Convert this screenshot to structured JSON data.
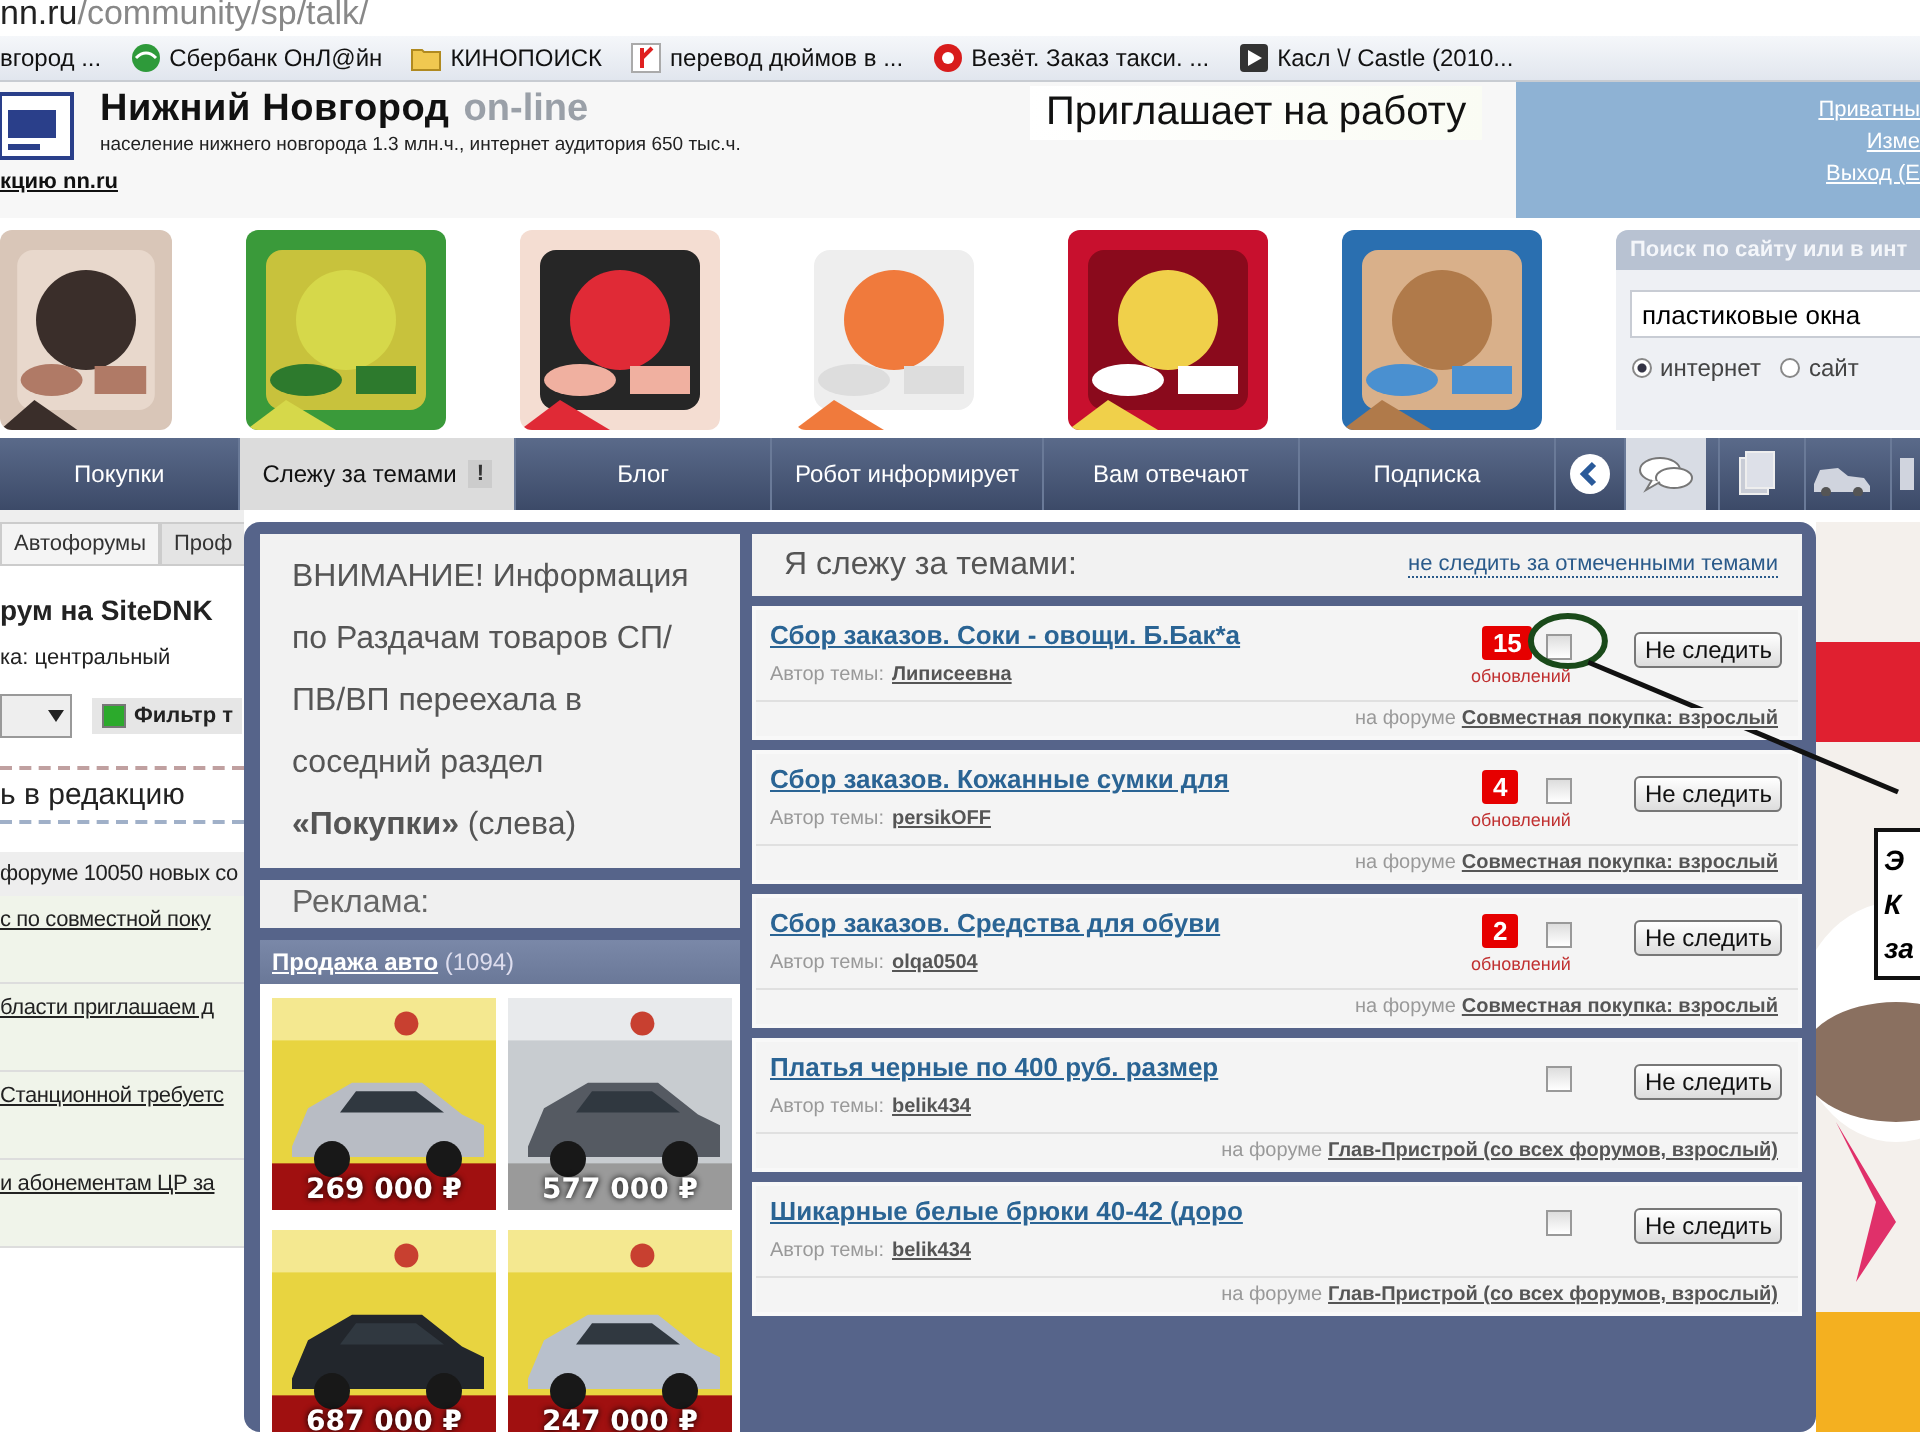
{
  "address_bar": {
    "host": "nn.ru",
    "path": "/community/sp/talk/"
  },
  "bookmarks": [
    {
      "label": "вгород ...",
      "kind": "page"
    },
    {
      "label": "Сбербанк ОнЛ@йн",
      "kind": "bank"
    },
    {
      "label": "КИНОПОИСК",
      "kind": "folder"
    },
    {
      "label": "перевод дюймов в ...",
      "kind": "yandex"
    },
    {
      "label": "Везёт. Заказ такси. ...",
      "kind": "taxi"
    },
    {
      "label": "Касл \\/ Castle (2010...",
      "kind": "video"
    }
  ],
  "header": {
    "title": "Нижний Новгород",
    "title_suffix": "on-line",
    "subtitle": "население нижнего новгорода 1.3 млн.ч., интернет аудитория 650 тыс.ч.",
    "link": "кцию nn.ru",
    "banner": "Приглашает на работу",
    "user_links": [
      "Приватны",
      "Изме",
      "Выход (Е"
    ]
  },
  "search": {
    "title": "Поиск по сайту или в инт",
    "value": "пластиковые окна",
    "options": [
      {
        "label": "интернет",
        "selected": true
      },
      {
        "label": "сайт",
        "selected": false
      }
    ]
  },
  "nav": {
    "tabs": [
      {
        "label": "Покупки",
        "selected": false
      },
      {
        "label": "Слежу за темами",
        "selected": true,
        "badge": "!"
      },
      {
        "label": "Блог",
        "selected": false
      },
      {
        "label": "Робот информирует",
        "selected": false
      },
      {
        "label": "Вам отвечают",
        "selected": false
      },
      {
        "label": "Подписка",
        "selected": false
      }
    ]
  },
  "left_panel": {
    "tabs": [
      {
        "label": "Автофорумы",
        "selected": true
      },
      {
        "label": "Проф",
        "selected": false
      }
    ],
    "heading": "рум на SiteDNK",
    "region": "ка: центральный",
    "filter": {
      "label": "Фильтр т",
      "checked": true
    },
    "editorial": "ь в редакцию",
    "stats": "форуме 10050 новых со",
    "links": [
      "с по совместной поку",
      "бласти приглашаем д",
      "Станционной требуетс",
      "и абонементам ЦР за"
    ]
  },
  "popup": {
    "notice": "ВНИМАНИЕ! Информация по Раздачам товаров СП/ПВ/ВП переехала в соседний раздел **«Покупки»** (слева)",
    "ads_title": "Реклама:",
    "ad_block": {
      "link": "Продажа авто",
      "count": "(1094)",
      "cars": [
        {
          "price": "269 000 ₽",
          "kind": "picture"
        },
        {
          "price": "577 000 ₽",
          "kind": "picture"
        },
        {
          "price": "687 000 ₽",
          "kind": "picture"
        },
        {
          "price": "247 000 ₽",
          "kind": "picture"
        }
      ]
    },
    "topics_title": "Я слежу за темами:",
    "unwatch_link": "не следить за отмеченными темами",
    "topics": [
      {
        "title": "Сбор заказов. Соки - овощи. Б.Бак*а",
        "author_label": "Автор темы:",
        "author": "Липисеевна",
        "updates": "15",
        "updates_label": "обновлений",
        "checked": false,
        "button": "Не следить",
        "forum_label": "на форуме",
        "forum": "Совместная покупка: взрослый"
      },
      {
        "title": "Сбор заказов. Кожанные сумки для",
        "author_label": "Автор темы:",
        "author": "persikOFF",
        "updates": "4",
        "updates_label": "обновлений",
        "checked": false,
        "button": "Не следить",
        "forum_label": "на форуме",
        "forum": "Совместная покупка: взрослый"
      },
      {
        "title": "Сбор заказов. Средства для обуви",
        "author_label": "Автор темы:",
        "author": "olqa0504",
        "updates": "2",
        "updates_label": "обновлений",
        "checked": false,
        "button": "Не следить",
        "forum_label": "на форуме",
        "forum": "Совместная покупка: взрослый"
      },
      {
        "title": "Платья черные по 400 руб. размер",
        "author_label": "Автор темы:",
        "author": "belik434",
        "checked": false,
        "button": "Не следить",
        "forum_label": "на форуме",
        "forum": "Глав-Пристрой (со всех форумов, взрослый)"
      },
      {
        "title": "Шикарные белые брюки 40-42 (доро",
        "author_label": "Автор темы:",
        "author": "belik434",
        "checked": false,
        "button": "Не следить",
        "forum_label": "на форуме",
        "forum": "Глав-Пристрой (со всех форумов, взрослый)"
      }
    ]
  },
  "annotation": {
    "lines": [
      "Э",
      "К",
      "за"
    ]
  }
}
